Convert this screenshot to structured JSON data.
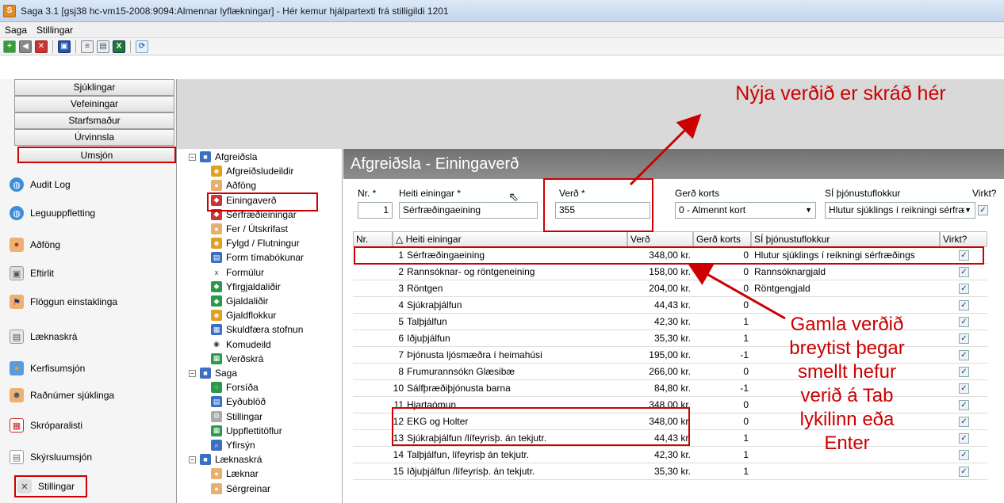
{
  "window": {
    "title": "Saga 3.1  [gsj38 hc-vm15-2008:9094:Almennar lyflækningar] - Hér kemur hjálpartexti frá stilligildi 1201"
  },
  "menu": {
    "items": [
      "Saga",
      "Stillingar"
    ]
  },
  "nav": {
    "sections": [
      "Sjúklingar",
      "Vefeiningar",
      "Starfsmaður",
      "Úrvinnsla",
      "Umsjón"
    ],
    "items": [
      {
        "label": "Audit Log",
        "icon": "globe-icon"
      },
      {
        "label": "Leguuppfletting",
        "icon": "globe-icon"
      },
      {
        "label": "Aðföng",
        "icon": "person-icon"
      },
      {
        "label": "Eftirlit",
        "icon": "monitor-icon"
      },
      {
        "label": "Flöggun einstaklinga",
        "icon": "person-flag-icon"
      },
      {
        "label": "Læknaskrá",
        "icon": "book-icon"
      },
      {
        "label": "Kerfisumsjón",
        "icon": "admin-icon"
      },
      {
        "label": "Raðnúmer sjúklinga",
        "icon": "users-icon"
      },
      {
        "label": "Skrópa­ralisti",
        "icon": "calendar-icon"
      },
      {
        "label": "Skýrsluumsjón",
        "icon": "report-icon"
      },
      {
        "label": "Stillingar",
        "icon": "tools-icon"
      }
    ]
  },
  "tree": {
    "nodes": [
      {
        "label": "Afgreiðsla",
        "level": 0,
        "icon": "folder-icon"
      },
      {
        "label": "Afgreiðsludeildir",
        "level": 1,
        "icon": "people-icon"
      },
      {
        "label": "Aðföng",
        "level": 1,
        "icon": "person-icon"
      },
      {
        "label": "Einingaverð",
        "level": 1,
        "icon": "price-icon"
      },
      {
        "label": "Sérfræðieiningar",
        "level": 1,
        "icon": "price-icon"
      },
      {
        "label": "Fer / Útskrifast",
        "level": 1,
        "icon": "person-icon"
      },
      {
        "label": "Fylgd / Flutningur",
        "level": 1,
        "icon": "people-icon"
      },
      {
        "label": "Form tímabókunar",
        "level": 1,
        "icon": "form-icon"
      },
      {
        "label": "Formúlur",
        "level": 1,
        "icon": "formula-icon"
      },
      {
        "label": "Yfirgjaldaliðir",
        "level": 1,
        "icon": "diamond-icon"
      },
      {
        "label": "Gjaldaliðir",
        "level": 1,
        "icon": "diamond-icon"
      },
      {
        "label": "Gjaldflokkur",
        "level": 1,
        "icon": "people-icon"
      },
      {
        "label": "Skuldfæra stofnun",
        "level": 1,
        "icon": "building-icon"
      },
      {
        "label": "Komudeild",
        "level": 1,
        "icon": "eye-icon"
      },
      {
        "label": "Verðskrá",
        "level": 1,
        "icon": "table-icon"
      },
      {
        "label": "Saga",
        "level": 0,
        "icon": "folder-icon"
      },
      {
        "label": "Forsíða",
        "level": 1,
        "icon": "dots-icon"
      },
      {
        "label": "Eyðublöð",
        "level": 1,
        "icon": "form-icon"
      },
      {
        "label": "Stillingar",
        "level": 1,
        "icon": "gear-icon"
      },
      {
        "label": "Uppflettitöflur",
        "level": 1,
        "icon": "table-icon"
      },
      {
        "label": "Yfirsýn",
        "level": 1,
        "icon": "magnifier-icon"
      },
      {
        "label": "Læknaskrá",
        "level": 0,
        "icon": "folder-icon"
      },
      {
        "label": "Læknar",
        "level": 1,
        "icon": "person-icon"
      },
      {
        "label": "Sérgreinar",
        "level": 1,
        "icon": "person-icon"
      }
    ]
  },
  "panel": {
    "title": "Afgreiðsla - Einingaverð"
  },
  "form": {
    "nr_label": "Nr. *",
    "nr_value": "1",
    "heiti_label": "Heiti einingar *",
    "heiti_value": "Sérfræðingaeining",
    "verd_label": "Verð *",
    "verd_value": "355",
    "gerd_label": "Gerð korts",
    "gerd_value": "0 - Almennt kort",
    "si_label": "SÍ þjónustuflokkur",
    "si_value": "Hlutur sjúklings í reikningi sérfræ",
    "virkt_label": "Virkt?"
  },
  "table": {
    "headers": [
      "Nr.",
      "△  Heiti einingar",
      "Verð",
      "Gerð korts",
      "SÍ þjónustuflokkur",
      "Virkt?"
    ],
    "rows": [
      [
        "1",
        "Sérfræðingaeining",
        "348,00 kr.",
        "0",
        "Hlutur sjúklings í reikningi sérfræðings"
      ],
      [
        "2",
        "Rannsóknar- og röntgeneining",
        "158,00 kr.",
        "0",
        "Rannsóknargjald"
      ],
      [
        "3",
        "Röntgen",
        "204,00 kr.",
        "0",
        "Röntgengjald"
      ],
      [
        "4",
        "Sjúkraþjálfun",
        "44,43 kr.",
        "0",
        ""
      ],
      [
        "5",
        "Talþjálfun",
        "42,30 kr.",
        "1",
        ""
      ],
      [
        "6",
        "Iðjuþjálfun",
        "35,30 kr.",
        "1",
        ""
      ],
      [
        "7",
        "Þjónusta ljósmæðra í heimahúsi",
        "195,00 kr.",
        "-1",
        ""
      ],
      [
        "8",
        "Frumurannsókn Glæsibæ",
        "266,00 kr.",
        "0",
        ""
      ],
      [
        "10",
        "Sálfþræðiþjónusta barna",
        "84,80 kr.",
        "-1",
        ""
      ],
      [
        "11",
        "Hjartaómun",
        "348,00 kr.",
        "0",
        ""
      ],
      [
        "12",
        "EKG og Holter",
        "348,00 kr.",
        "0",
        ""
      ],
      [
        "13",
        "Sjúkraþjálfun /lífeyrisþ. án tekjutr.",
        "44,43 kr.",
        "1",
        ""
      ],
      [
        "14",
        "Talþjálfun, lífeyrisþ án tekjutr.",
        "42,30 kr.",
        "1",
        ""
      ],
      [
        "15",
        "Iðjuþjálfun /lífeyrisþ. án tekjutr.",
        "35,30 kr.",
        "1",
        ""
      ]
    ]
  },
  "annotations": {
    "top": "Nýja verðið er skráð hér",
    "right": [
      "Gamla verðið",
      "breytist þegar",
      "smellt hefur",
      "verið á Tab",
      "lykilinn eða",
      "Enter"
    ]
  }
}
